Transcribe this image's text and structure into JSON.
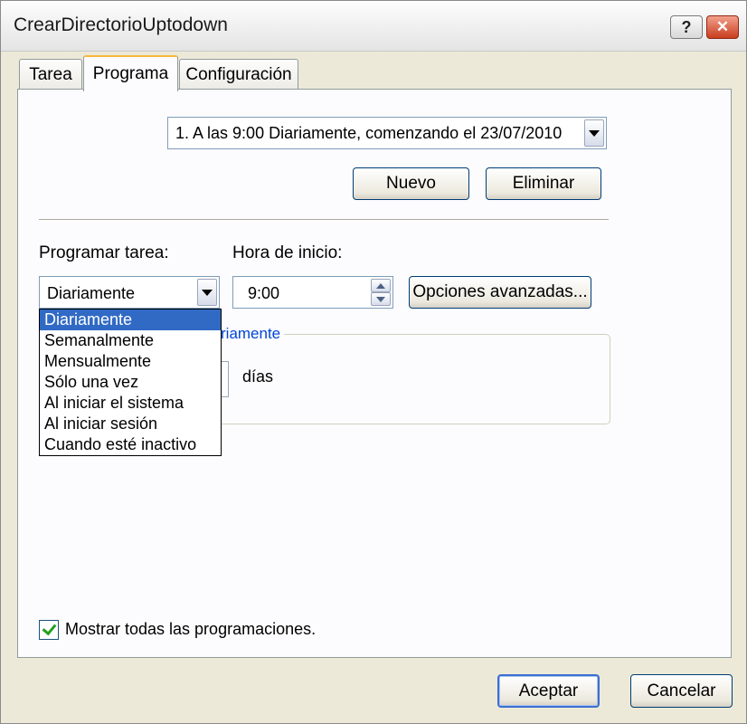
{
  "window": {
    "title": "CrearDirectorioUptodown",
    "help_glyph": "?",
    "close_glyph": "✕"
  },
  "tabs": [
    {
      "label": "Tarea"
    },
    {
      "label": "Programa"
    },
    {
      "label": "Configuración"
    }
  ],
  "schedule": {
    "selected": "1. A las 9:00 Diariamente, comenzando el 23/07/2010"
  },
  "buttons": {
    "new_label": "Nuevo",
    "delete_label": "Eliminar",
    "advanced_label": "Opciones avanzadas...",
    "ok_label": "Aceptar",
    "cancel_label": "Cancelar"
  },
  "schedule_task": {
    "label": "Programar tarea:",
    "value": "Diariamente",
    "options": [
      "Diariamente",
      "Semanalmente",
      "Mensualmente",
      "Sólo una vez",
      "Al iniciar el sistema",
      "Al iniciar sesión",
      "Cuando esté inactivo"
    ]
  },
  "start_time": {
    "label": "Hora de inicio:",
    "value": "9:00"
  },
  "group": {
    "legend_partial": "riamente",
    "unit_label": "días"
  },
  "show_all": {
    "label": "Mostrar todas las programaciones.",
    "checked": true
  },
  "colors": {
    "selection": "#316ac5",
    "group_legend": "#0046d5",
    "close_button": "#c93e1f",
    "active_tab_highlight": "#f6b73c"
  }
}
